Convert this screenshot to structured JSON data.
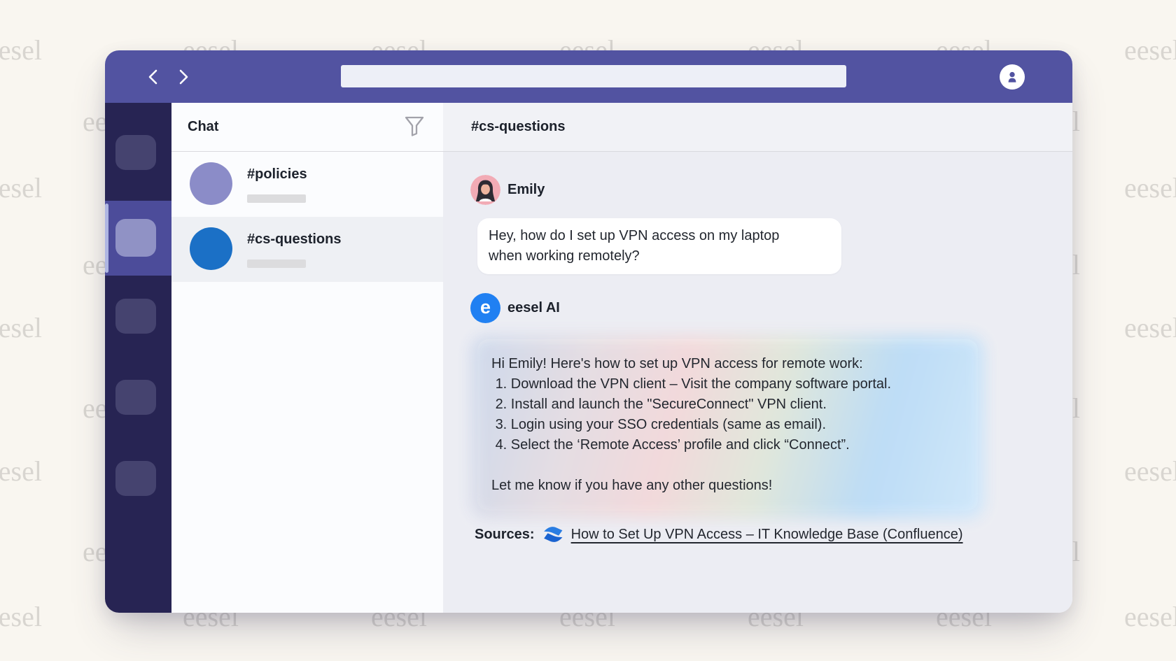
{
  "watermark": {
    "text": "eesel"
  },
  "titlebar": {
    "search_value": "",
    "icons": {
      "back": "chevron-left-icon",
      "forward": "chevron-right-icon",
      "profile": "person-icon"
    }
  },
  "chat_list": {
    "title": "Chat",
    "filter_icon": "funnel-icon",
    "channels": [
      {
        "name": "#policies"
      },
      {
        "name": "#cs-questions",
        "selected": true
      }
    ]
  },
  "conversation": {
    "header": "#cs-questions",
    "messages": [
      {
        "author": "Emily",
        "avatar_icon": "woman-illustration-avatar",
        "lines": [
          "Hey, how do I set up VPN access on my laptop",
          "when working remotely?"
        ]
      },
      {
        "author": "eesel AI",
        "avatar_icon": "eesel-logo-e",
        "lines": [
          "Hi Emily! Here's how to set up VPN access for remote work:",
          " 1. Download the VPN client – Visit the company software portal.",
          " 2. Install and launch the \"SecureConnect\" VPN client.",
          " 3. Login using your SSO credentials (same as email).",
          " 4. Select the ‘Remote Access’ profile and click “Connect”.",
          "",
          "Let me know if you have any other questions!"
        ]
      }
    ],
    "sources": {
      "label": "Sources:",
      "icon": "confluence-logo-icon",
      "link_text": "How to Set Up VPN Access – IT Knowledge Base (Confluence)"
    }
  },
  "colors": {
    "titlebar": "#5253a1",
    "rail": "#272453",
    "rail-icon": "#45436f",
    "rail-strip": "#4c4c9a",
    "rail-icon-active": "#9092c5",
    "lavender": "#8b8cc8",
    "accent-blue": "#1b70c6",
    "eesel-blue": "#2080f2",
    "emily-pink": "#f2abb5",
    "confluence-blue": "#1f6fe0"
  }
}
